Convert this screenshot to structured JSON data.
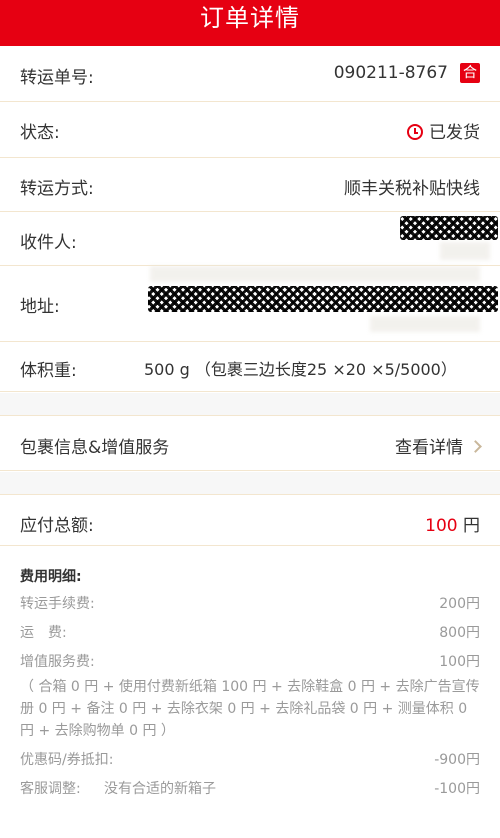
{
  "header": {
    "title": "订单详情"
  },
  "rows": {
    "tracking": {
      "label": "转运单号:",
      "value": "090211-8767",
      "badge": "合"
    },
    "status": {
      "label": "状态:",
      "value": "已发货"
    },
    "method": {
      "label": "转运方式:",
      "value": "顺丰关税补贴快线"
    },
    "recipient": {
      "label": "收件人:"
    },
    "address": {
      "label": "地址:"
    },
    "weight": {
      "label": "体积重:",
      "value": "500 g （包裹三边长度25 ×20 ×5/5000）"
    }
  },
  "package_info": {
    "label": "包裹信息&增值服务",
    "link": "查看详情"
  },
  "total": {
    "label": "应付总额:",
    "amount": "100",
    "unit": "円"
  },
  "fees": {
    "title": "费用明细:",
    "items": [
      {
        "label": "转运手续费:",
        "value": "200円"
      },
      {
        "label": "运　费:",
        "value": "800円"
      },
      {
        "label": "增值服务费:",
        "value": "100円"
      }
    ],
    "note": "（ 合箱 0 円 + 使用付费新纸箱 100 円 + 去除鞋盒 0 円 + 去除广告宣传册 0 円 + 备注 0 円 + 去除衣架 0 円 + 去除礼品袋 0 円 + 测量体积 0 円 + 去除购物单 0 円 ）",
    "discount": {
      "label": "优惠码/券抵扣:",
      "value": "-900円"
    },
    "adjust": {
      "label": "客服调整:",
      "remark": "没有合适的新箱子",
      "value": "-100円"
    }
  },
  "colors": {
    "brand_red": "#e60012",
    "link_gray": "#c9b79b"
  }
}
